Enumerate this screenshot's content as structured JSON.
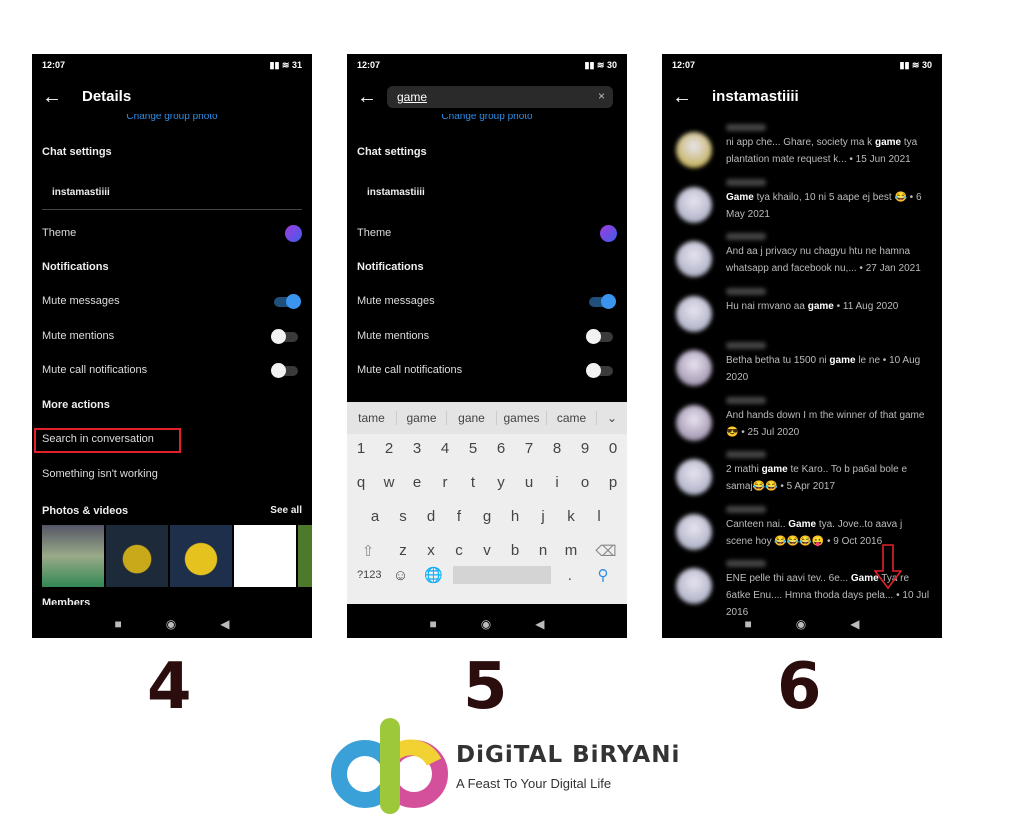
{
  "status": {
    "time": "12:07",
    "battery1": "31",
    "battery": "30"
  },
  "details": {
    "back": "←",
    "title": "Details",
    "change_photo": "Change group photo",
    "chat_settings": "Chat settings",
    "group_name": "instamastiiii",
    "theme": "Theme",
    "notifications": "Notifications",
    "mute_messages": "Mute messages",
    "mute_mentions": "Mute mentions",
    "mute_calls": "Mute call notifications",
    "more_actions": "More actions",
    "search_conv": "Search in conversation",
    "something_wrong": "Something isn't working",
    "photos": "Photos & videos",
    "see_all": "See all",
    "members": "Members",
    "toggles": {
      "mute_messages": true,
      "mute_mentions": false,
      "mute_calls": false
    }
  },
  "search": {
    "query": "game",
    "clear": "×"
  },
  "keyboard": {
    "suggestions": [
      "tame",
      "game",
      "gane",
      "games",
      "came"
    ],
    "rows": [
      [
        "1",
        "2",
        "3",
        "4",
        "5",
        "6",
        "7",
        "8",
        "9",
        "0"
      ],
      [
        "q",
        "w",
        "e",
        "r",
        "t",
        "y",
        "u",
        "i",
        "o",
        "p"
      ],
      [
        "a",
        "s",
        "d",
        "f",
        "g",
        "h",
        "j",
        "k",
        "l"
      ],
      [
        "⇧",
        "z",
        "x",
        "c",
        "v",
        "b",
        "n",
        "m",
        "⌫"
      ]
    ],
    "symbols": "?123",
    "period": "."
  },
  "results": {
    "title": "instamastiiii",
    "items": [
      {
        "segs": [
          [
            "ni app che... Ghare, society ma k ",
            0
          ],
          [
            "game",
            1
          ],
          [
            " tya plantation mate request k... • 15 Jun 2021",
            0
          ]
        ],
        "color": "#b9a02a"
      },
      {
        "segs": [
          [
            "Game",
            1
          ],
          [
            " tya khailo, 10 ni 5 aape ej best 😂 • 6 May 2021",
            0
          ]
        ],
        "color": "#9aa0b8"
      },
      {
        "segs": [
          [
            "And aa j privacy nu chagyu htu ne hamna whatsapp and facebook nu,... • 27 Jan 2021",
            0
          ]
        ],
        "color": "#9aa0b8"
      },
      {
        "segs": [
          [
            "Hu nai rmvano aa ",
            0
          ],
          [
            "game",
            1
          ],
          [
            " • 11 Aug 2020",
            0
          ]
        ],
        "color": "#9aa0b8"
      },
      {
        "segs": [
          [
            "Betha betha tu 1500 ni ",
            0
          ],
          [
            "game",
            1
          ],
          [
            " le ne • 10 Aug 2020",
            0
          ]
        ],
        "color": "#8a7a9a"
      },
      {
        "segs": [
          [
            "And hands down I m the winner of that game 😎 • 25 Jul 2020",
            0
          ]
        ],
        "color": "#8a7a9a"
      },
      {
        "segs": [
          [
            "2 mathi ",
            0
          ],
          [
            "game",
            1
          ],
          [
            " te Karo.. To b pa6al bole e samaj😂😂 • 5 Apr 2017",
            0
          ]
        ],
        "color": "#9aa0b8"
      },
      {
        "segs": [
          [
            "Canteen nai.. ",
            0
          ],
          [
            "Game",
            1
          ],
          [
            " tya. Jove..to aava j scene hoy 😂😂😂😛 • 9 Oct 2016",
            0
          ]
        ],
        "color": "#9aa0b8"
      },
      {
        "segs": [
          [
            "ENE pelle thi aavi tev.. 6e... ",
            0
          ],
          [
            "Game",
            1
          ],
          [
            " Tya re 6atke Enu.... Hmna thoda days pela... • 10 Jul 2016",
            0
          ]
        ],
        "color": "#9aa0b8"
      }
    ]
  },
  "steps": [
    "4",
    "5",
    "6"
  ],
  "brand": {
    "name": "DiGiTAL BiRYANi",
    "tagline": "A Feast To Your Digital Life"
  },
  "colors": {
    "accent": "#2d8ee6",
    "highlight": "#e3212b"
  }
}
